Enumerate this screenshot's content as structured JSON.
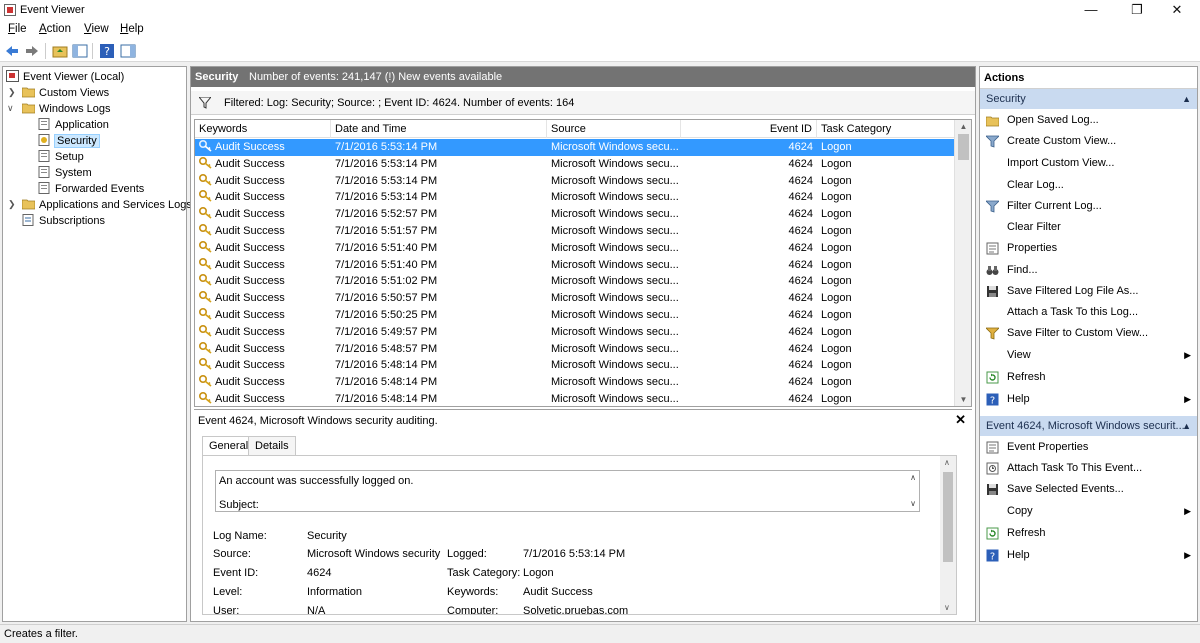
{
  "window": {
    "title": "Event Viewer"
  },
  "menu": [
    {
      "label": "File",
      "ul": "F",
      "rest": "ile"
    },
    {
      "label": "Action",
      "ul": "A",
      "rest": "ction"
    },
    {
      "label": "View",
      "ul": "V",
      "rest": "iew"
    },
    {
      "label": "Help",
      "ul": "H",
      "rest": "elp"
    }
  ],
  "tree": {
    "root": "Event Viewer (Local)",
    "custom_views": "Custom Views",
    "windows_logs": "Windows Logs",
    "application": "Application",
    "security": "Security",
    "setup": "Setup",
    "system": "System",
    "forwarded": "Forwarded Events",
    "apps_services": "Applications and Services Logs",
    "subscriptions": "Subscriptions"
  },
  "main": {
    "title": "Security",
    "count_text": "Number of events: 241,147 (!) New events available",
    "filter_text": "Filtered: Log: Security; Source: ; Event ID: 4624. Number of events: 164",
    "columns": {
      "keywords": "Keywords",
      "date": "Date and Time",
      "source": "Source",
      "event_id": "Event ID",
      "task": "Task Category"
    },
    "rows": [
      {
        "kw": "Audit Success",
        "date": "7/1/2016 5:53:14 PM",
        "src": "Microsoft Windows secu...",
        "id": "4624",
        "task": "Logon"
      },
      {
        "kw": "Audit Success",
        "date": "7/1/2016 5:53:14 PM",
        "src": "Microsoft Windows secu...",
        "id": "4624",
        "task": "Logon"
      },
      {
        "kw": "Audit Success",
        "date": "7/1/2016 5:53:14 PM",
        "src": "Microsoft Windows secu...",
        "id": "4624",
        "task": "Logon"
      },
      {
        "kw": "Audit Success",
        "date": "7/1/2016 5:53:14 PM",
        "src": "Microsoft Windows secu...",
        "id": "4624",
        "task": "Logon"
      },
      {
        "kw": "Audit Success",
        "date": "7/1/2016 5:52:57 PM",
        "src": "Microsoft Windows secu...",
        "id": "4624",
        "task": "Logon"
      },
      {
        "kw": "Audit Success",
        "date": "7/1/2016 5:51:57 PM",
        "src": "Microsoft Windows secu...",
        "id": "4624",
        "task": "Logon"
      },
      {
        "kw": "Audit Success",
        "date": "7/1/2016 5:51:40 PM",
        "src": "Microsoft Windows secu...",
        "id": "4624",
        "task": "Logon"
      },
      {
        "kw": "Audit Success",
        "date": "7/1/2016 5:51:40 PM",
        "src": "Microsoft Windows secu...",
        "id": "4624",
        "task": "Logon"
      },
      {
        "kw": "Audit Success",
        "date": "7/1/2016 5:51:02 PM",
        "src": "Microsoft Windows secu...",
        "id": "4624",
        "task": "Logon"
      },
      {
        "kw": "Audit Success",
        "date": "7/1/2016 5:50:57 PM",
        "src": "Microsoft Windows secu...",
        "id": "4624",
        "task": "Logon"
      },
      {
        "kw": "Audit Success",
        "date": "7/1/2016 5:50:25 PM",
        "src": "Microsoft Windows secu...",
        "id": "4624",
        "task": "Logon"
      },
      {
        "kw": "Audit Success",
        "date": "7/1/2016 5:49:57 PM",
        "src": "Microsoft Windows secu...",
        "id": "4624",
        "task": "Logon"
      },
      {
        "kw": "Audit Success",
        "date": "7/1/2016 5:48:57 PM",
        "src": "Microsoft Windows secu...",
        "id": "4624",
        "task": "Logon"
      },
      {
        "kw": "Audit Success",
        "date": "7/1/2016 5:48:14 PM",
        "src": "Microsoft Windows secu...",
        "id": "4624",
        "task": "Logon"
      },
      {
        "kw": "Audit Success",
        "date": "7/1/2016 5:48:14 PM",
        "src": "Microsoft Windows secu...",
        "id": "4624",
        "task": "Logon"
      },
      {
        "kw": "Audit Success",
        "date": "7/1/2016 5:48:14 PM",
        "src": "Microsoft Windows secu...",
        "id": "4624",
        "task": "Logon"
      }
    ]
  },
  "detail": {
    "title": "Event 4624, Microsoft Windows security auditing.",
    "tabs": {
      "general": "General",
      "details": "Details"
    },
    "message_line1": "An account was successfully logged on.",
    "message_line2": "Subject:",
    "log_name_label": "Log Name:",
    "log_name": "Security",
    "source_label": "Source:",
    "source": "Microsoft Windows security",
    "logged_label": "Logged:",
    "logged": "7/1/2016 5:53:14 PM",
    "event_id_label": "Event ID:",
    "event_id": "4624",
    "task_label": "Task Category:",
    "task": "Logon",
    "level_label": "Level:",
    "level": "Information",
    "keywords_label": "Keywords:",
    "keywords": "Audit Success",
    "user_label": "User:",
    "user": "N/A",
    "computer_label": "Computer:",
    "computer": "Solvetic.pruebas.com"
  },
  "actions": {
    "title": "Actions",
    "section1": "Security",
    "items1": [
      "Open Saved Log...",
      "Create Custom View...",
      "Import Custom View...",
      "Clear Log...",
      "Filter Current Log...",
      "Clear Filter",
      "Properties",
      "Find...",
      "Save Filtered Log File As...",
      "Attach a Task To this Log...",
      "Save Filter to Custom View...",
      "View",
      "Refresh",
      "Help"
    ],
    "section2": "Event 4624, Microsoft Windows securit...",
    "items2": [
      "Event Properties",
      "Attach Task To This Event...",
      "Save Selected Events...",
      "Copy",
      "Refresh",
      "Help"
    ]
  },
  "status": {
    "text": "Creates a filter."
  },
  "colors": {
    "selection": "#3399ff",
    "section_header": "#c9daf0",
    "panel_header": "#737373"
  }
}
